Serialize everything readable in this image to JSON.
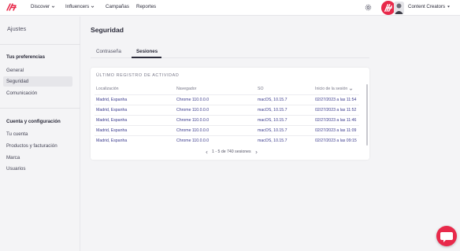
{
  "topbar": {
    "nav": [
      {
        "label": "Discover",
        "has_chevron": true
      },
      {
        "label": "Influencers",
        "has_chevron": true
      },
      {
        "label": "Campañas",
        "has_chevron": false
      },
      {
        "label": "Reportes",
        "has_chevron": false
      }
    ],
    "account_label": "Content Creators",
    "brand_color": "#e8294a"
  },
  "sidebar": {
    "title": "Ajustes",
    "sections": [
      {
        "label": "Tus preferencias",
        "items": [
          "General",
          "Seguridad",
          "Comunicación"
        ]
      },
      {
        "label": "Cuenta y configuración",
        "items": [
          "Tu cuenta",
          "Productos y facturación",
          "Marca",
          "Usuarios"
        ]
      }
    ],
    "active_item": "Seguridad"
  },
  "main": {
    "title": "Seguridad",
    "tabs": [
      {
        "label": "Contraseña",
        "active": false
      },
      {
        "label": "Sesiones",
        "active": true
      }
    ]
  },
  "activity": {
    "heading": "ÚLTIMO REGISTRO DE ACTIVIDAD",
    "columns": [
      "Localización",
      "Navegador",
      "SO",
      "Inicio de la sesión"
    ],
    "sort_column": "Inicio de la sesión",
    "rows": [
      [
        "Madrid, Espanha",
        "Chrome 110.0.0.0",
        "macOS, 10.15.7",
        "02/27/2023 a las 11:54"
      ],
      [
        "Madrid, Espanha",
        "Chrome 110.0.0.0",
        "macOS, 10.15.7",
        "02/27/2023 a las 11:52"
      ],
      [
        "Madrid, Espanha",
        "Chrome 110.0.0.0",
        "macOS, 10.15.7",
        "02/27/2023 a las 11:46"
      ],
      [
        "Madrid, Espanha",
        "Chrome 110.0.0.0",
        "macOS, 10.15.7",
        "02/27/2023 a las 11:09"
      ],
      [
        "Madrid, Espanha",
        "Chrome 110.0.0.0",
        "macOS, 10.15.7",
        "02/27/2023 a las 09:15"
      ]
    ],
    "pagination": "1 - 5 de 740 sesiones"
  }
}
